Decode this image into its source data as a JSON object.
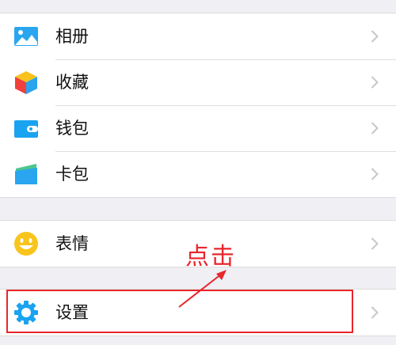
{
  "menu": {
    "group1": [
      {
        "label": "相册",
        "icon": "photo-album-icon"
      },
      {
        "label": "收藏",
        "icon": "favorites-cube-icon"
      },
      {
        "label": "钱包",
        "icon": "wallet-icon"
      },
      {
        "label": "卡包",
        "icon": "card-package-icon"
      }
    ],
    "group2": [
      {
        "label": "表情",
        "icon": "smiley-face-icon"
      }
    ],
    "group3": [
      {
        "label": "设置",
        "icon": "gear-icon"
      }
    ]
  },
  "annotation": {
    "text": "点击",
    "color": "#e8262b"
  },
  "colors": {
    "accent_blue": "#1aa3f0",
    "smiley_yellow": "#f8c51c",
    "background": "#efeff4"
  }
}
